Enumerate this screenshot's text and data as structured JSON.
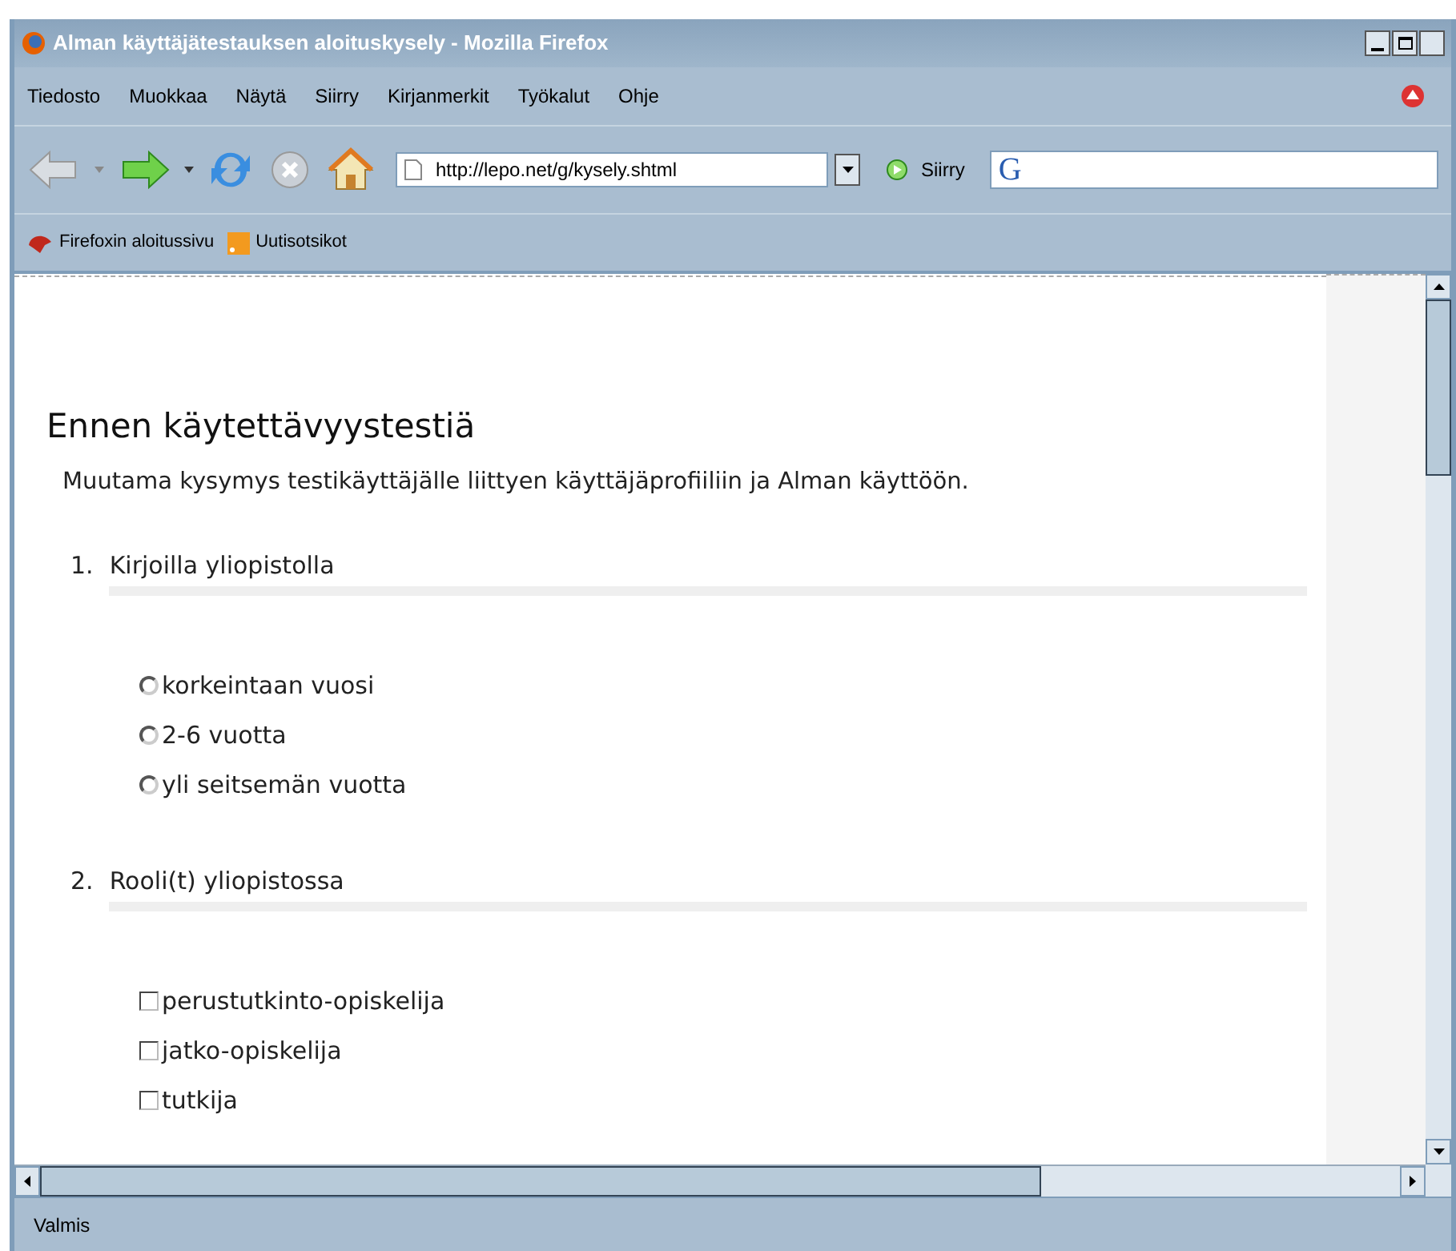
{
  "window": {
    "title": "Alman käyttäjätestauksen aloituskysely - Mozilla Firefox"
  },
  "menu": [
    "Tiedosto",
    "Muokkaa",
    "Näytä",
    "Siirry",
    "Kirjanmerkit",
    "Työkalut",
    "Ohje"
  ],
  "toolbar": {
    "url": "http://lepo.net/g/kysely.shtml",
    "go_label": "Siirry",
    "search_logo": "G"
  },
  "bookmarks": [
    "Firefoxin aloitussivu",
    "Uutisotsikot"
  ],
  "page": {
    "heading": "Ennen käytettävyystestiä",
    "intro": "Muutama kysymys testikäyttäjälle liittyen käyttäjäprofiiliin ja Alman käyttöön.",
    "questions": [
      {
        "number": "1.",
        "title": "Kirjoilla yliopistolla",
        "kind": "radio",
        "options": [
          {
            "label": "korkeintaan vuosi",
            "selected": false
          },
          {
            "label": "2-6 vuotta",
            "selected": false
          },
          {
            "label": "yli seitsemän vuotta",
            "selected": false
          }
        ]
      },
      {
        "number": "2.",
        "title": "Rooli(t) yliopistossa",
        "kind": "checkbox",
        "options": [
          {
            "label": "perustutkinto-opiskelija",
            "checked": false
          },
          {
            "label": "jatko-opiskelija",
            "checked": false
          },
          {
            "label": "tutkija",
            "checked": false
          }
        ]
      }
    ]
  },
  "status_bar": {
    "text": "Valmis"
  }
}
